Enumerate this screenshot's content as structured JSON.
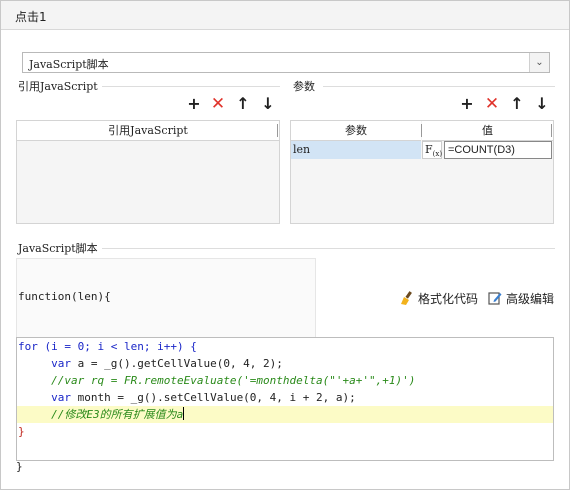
{
  "dialog": {
    "title": "点击1"
  },
  "type_select": {
    "value": "JavaScript脚本",
    "arrow": "chevron-down"
  },
  "ref_section": {
    "label": "引用JavaScript",
    "column_header": "引用JavaScript",
    "toolbar": {
      "add": "+",
      "delete": "✕",
      "up": "↑",
      "down": "↓"
    }
  },
  "param_section": {
    "label": "参数",
    "columns": [
      "参数",
      "值"
    ],
    "toolbar": {
      "add": "+",
      "delete": "✕",
      "up": "↑",
      "down": "↓"
    },
    "rows": [
      {
        "name": "len",
        "fx_label": "F(x)",
        "value": "=COUNT(D3)"
      }
    ]
  },
  "script_section": {
    "label": "JavaScript脚本",
    "signature": "function(len){",
    "format_label": "格式化代码",
    "advanced_label": "高级编辑",
    "closing": "}"
  },
  "code": {
    "l1_kw": "for",
    "l1_rest": " (i = 0; i < len; i++) {",
    "l2_kw": "var",
    "l2_rest": " a = _g().getCellValue(0, 4, 2);",
    "l3": "//var rq = FR.remoteEvaluate('=monthdelta(\"'+a+'\",+1)')",
    "l4_kw": "var",
    "l4_rest": " month = _g().setCellValue(0, 4, i + 2, a);",
    "l5_cm": "//修改E3的所有扩展值为a",
    "l6": "}"
  },
  "colors": {
    "keyword": "#1a26c8",
    "comment": "#2a8a1a",
    "delete": "#e0332b",
    "selected_row": "#d2e4f5",
    "highlight_line": "#fcfbc6"
  }
}
